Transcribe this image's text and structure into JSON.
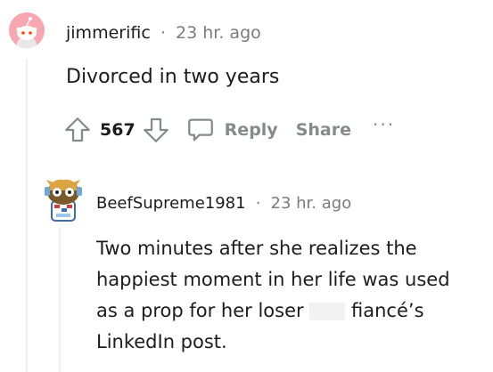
{
  "comments": [
    {
      "username": "jimmerific",
      "separator": "·",
      "time": "23 hr. ago",
      "body": "Divorced in two years",
      "votes": "567",
      "reply_label": "Reply",
      "share_label": "Share",
      "more_label": "···",
      "avatar_color": "#f8a7b1"
    },
    {
      "username": "BeefSupreme1981",
      "separator": "·",
      "time": "23 hr. ago",
      "body_line1": "Two minutes after she realizes the",
      "body_line2": "happiest moment in her life was used",
      "body_line3a": "as a prop for her loser",
      "body_line3b": "fiancé’s",
      "body_line4": "LinkedIn post."
    }
  ],
  "colors": {
    "text": "#1c1c1c",
    "meta": "#7c7c7c",
    "action": "#878a8c",
    "thread_line": "#edeff1"
  }
}
